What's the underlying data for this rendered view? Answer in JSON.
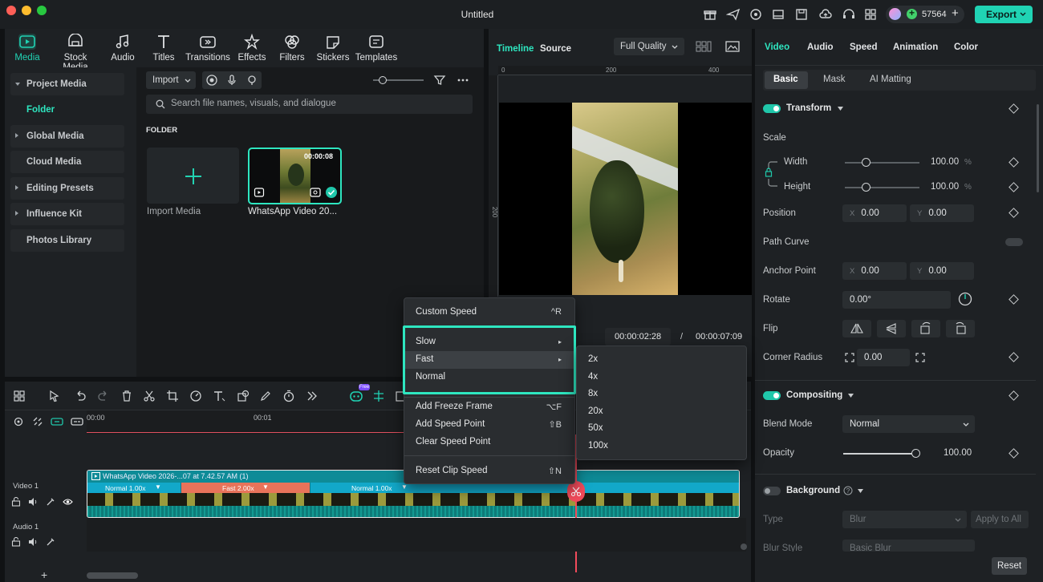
{
  "window": {
    "title": "Untitled"
  },
  "credits": {
    "value": "57564"
  },
  "export": {
    "label": "Export"
  },
  "media_tabs": [
    {
      "label": "Media",
      "icon": "media-icon"
    },
    {
      "label": "Stock Media",
      "icon": "stock-media-icon"
    },
    {
      "label": "Audio",
      "icon": "audio-icon"
    },
    {
      "label": "Titles",
      "icon": "titles-icon"
    },
    {
      "label": "Transitions",
      "icon": "transitions-icon"
    },
    {
      "label": "Effects",
      "icon": "effects-icon"
    },
    {
      "label": "Filters",
      "icon": "filters-icon"
    },
    {
      "label": "Stickers",
      "icon": "stickers-icon"
    },
    {
      "label": "Templates",
      "icon": "templates-icon"
    }
  ],
  "sidebar": {
    "project_media": "Project Media",
    "folder": "Folder",
    "global_media": "Global Media",
    "cloud_media": "Cloud Media",
    "editing_presets": "Editing Presets",
    "influence_kit": "Influence Kit",
    "photos_library": "Photos Library"
  },
  "media": {
    "import_label": "Import",
    "search_placeholder": "Search file names, visuals, and dialogue",
    "folder_heading": "FOLDER",
    "import_media_label": "Import Media",
    "clip_name": "WhatsApp Video 20...",
    "clip_duration": "00:00:08"
  },
  "preview": {
    "tab_timeline": "Timeline",
    "tab_source": "Source",
    "quality": "Full Quality",
    "ruler_0": "0",
    "ruler_200": "200",
    "ruler_400": "400",
    "ruler_v200": "200",
    "current_time": "00:00:02:28",
    "separator": "/",
    "total_time": "00:00:07:09"
  },
  "props": {
    "tabs": [
      "Video",
      "Audio",
      "Speed",
      "Animation",
      "Color"
    ],
    "subtabs": [
      "Basic",
      "Mask",
      "AI Matting"
    ],
    "transform": "Transform",
    "scale": "Scale",
    "width": "Width",
    "width_value": "100.00",
    "height": "Height",
    "height_value": "100.00",
    "percent": "%",
    "position": "Position",
    "pos_x_label": "X",
    "pos_x": "0.00",
    "pos_y_label": "Y",
    "pos_y": "0.00",
    "path_curve": "Path Curve",
    "anchor_point": "Anchor Point",
    "anchor_x_label": "X",
    "anchor_x": "0.00",
    "anchor_y_label": "Y",
    "anchor_y": "0.00",
    "rotate": "Rotate",
    "rotate_value": "0.00°",
    "flip": "Flip",
    "corner_radius": "Corner Radius",
    "corner_value": "0.00",
    "compositing": "Compositing",
    "blend_mode": "Blend Mode",
    "blend_value": "Normal",
    "opacity": "Opacity",
    "opacity_value": "100.00",
    "opacity_level": 1.0,
    "width_level": 0.28,
    "height_level": 0.28,
    "background": "Background",
    "type": "Type",
    "type_value": "Blur",
    "apply_to_all": "Apply to All",
    "blur_style": "Blur Style",
    "blur_style_value": "Basic Blur",
    "reset": "Reset"
  },
  "timeline": {
    "t0": "00:00",
    "t1": "00:01",
    "free_badge": "Free",
    "video_track": "Video 1",
    "audio_track": "Audio 1",
    "clip_title": "WhatsApp Video 2026-...07 at 7.42.57 AM (1)",
    "seg1": "Normal 1.00x",
    "seg2": "Fast 2.00x",
    "seg3": "Normal 1.00x"
  },
  "speed_menu": {
    "custom_speed": "Custom Speed",
    "custom_speed_sc": "^R",
    "slow": "Slow",
    "fast": "Fast",
    "normal": "Normal",
    "add_freeze_frame": "Add Freeze Frame",
    "add_freeze_frame_sc": "⌥F",
    "add_speed_point": "Add Speed Point",
    "add_speed_point_sc": "⇧B",
    "clear_speed_point": "Clear Speed Point",
    "reset_clip_speed": "Reset Clip Speed",
    "reset_clip_speed_sc": "⇧N"
  },
  "fast_submenu": [
    "2x",
    "4x",
    "8x",
    "20x",
    "50x",
    "100x"
  ],
  "colors": {
    "accent": "#20d3b4",
    "highlight": "#2ee6c0",
    "playhead": "#f24b5b",
    "fast_segment": "#e8735a",
    "normal_segment": "#12a8c9"
  }
}
